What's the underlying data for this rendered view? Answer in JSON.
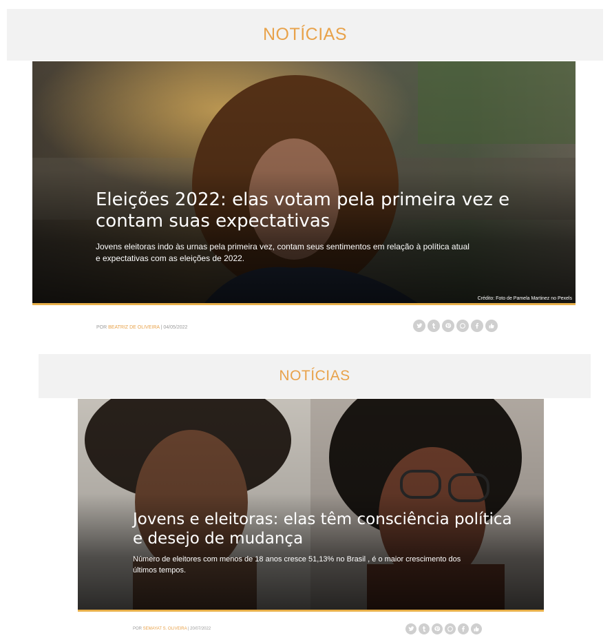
{
  "articles": [
    {
      "section": "NOTÍCIAS",
      "headline_line1": "Eleições 2022: elas votam pela primeira vez e",
      "headline_line2": "contam suas expectativas",
      "summary_line1": "Jovens eleitoras indo às urnas pela primeira vez, contam seus sentimentos em relação à política atual",
      "summary_line2": "e expectativas com as eleições de 2022.",
      "credit": "Crédito: Foto de Pamela Martinez no Pexels",
      "byline_prefix": "POR ",
      "author": "BEATRIZ DE OLIVEIRA",
      "date": " | 04/05/2022"
    },
    {
      "section": "NOTÍCIAS",
      "headline_line1": "Jovens e eleitoras: elas têm consciência política",
      "headline_line2": "e desejo de mudança",
      "summary_line1": "Número de eleitores com menos de 18 anos cresce 51,13% no Brasil , é o maior crescimento dos",
      "summary_line2": "últimos tempos.",
      "byline_prefix": "POR ",
      "author": "SEMAYAT S. OLIVEIRA",
      "date": " | 20/07/2022"
    }
  ],
  "share_icons": [
    "twitter-icon",
    "tumblr-icon",
    "pinterest-icon",
    "whatsapp-icon",
    "facebook-icon",
    "thumbs-up-icon"
  ],
  "colors": {
    "accent": "#e8a24a",
    "header_bg": "#f2f2f2",
    "icon_gray": "#cfcfcf"
  }
}
